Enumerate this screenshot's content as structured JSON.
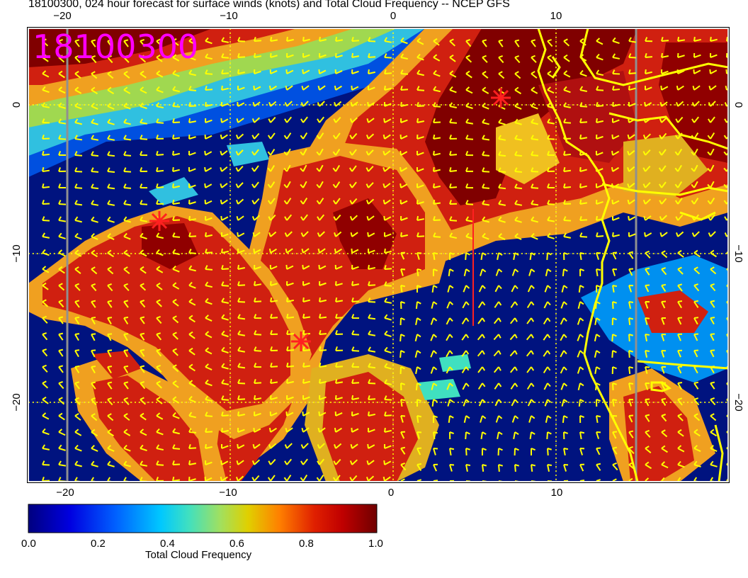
{
  "title": "18100300, 024 hour forecast for surface winds (knots) and Total Cloud Frequency -- NCEP GFS",
  "stamp": "18100300",
  "x_ticks": [
    "−20",
    "−10",
    "0",
    "10"
  ],
  "y_ticks": [
    "0",
    "−10",
    "−20"
  ],
  "colorbar": {
    "label": "Total Cloud Frequency",
    "ticks": [
      "0.0",
      "0.2",
      "0.4",
      "0.6",
      "0.8",
      "1.0"
    ],
    "range": [
      0.0,
      1.0
    ],
    "colors": [
      "#00007f",
      "#0000d0",
      "#0060ff",
      "#00c8ff",
      "#40e0c0",
      "#a0e060",
      "#e0d000",
      "#ff8000",
      "#e02000",
      "#c00000",
      "#700000"
    ]
  },
  "overlay": {
    "wind_barb_color": "#ffff00",
    "coastline_color": "#ffff00",
    "marker_color": "#ff2020"
  }
}
